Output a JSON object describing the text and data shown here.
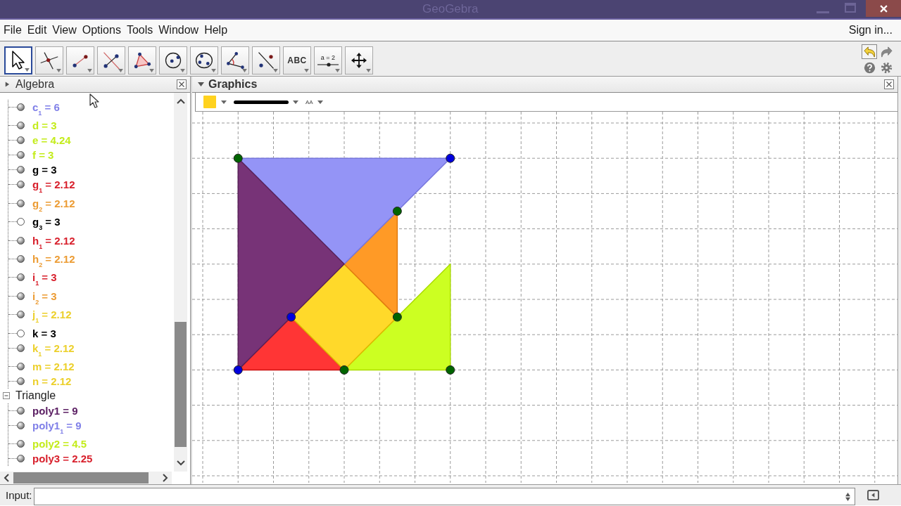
{
  "window": {
    "title": "GeoGebra"
  },
  "menu": {
    "items": [
      "File",
      "Edit",
      "View",
      "Options",
      "Tools",
      "Window",
      "Help"
    ],
    "sign_in": "Sign in..."
  },
  "toolbar": {
    "tools": [
      {
        "kind": "move",
        "selected": true
      },
      {
        "kind": "intersect",
        "selected": false
      },
      {
        "kind": "segment",
        "selected": false
      },
      {
        "kind": "perpendicular",
        "selected": false
      },
      {
        "kind": "polygon",
        "selected": false
      },
      {
        "kind": "circle",
        "selected": false
      },
      {
        "kind": "conic",
        "selected": false
      },
      {
        "kind": "angle",
        "selected": false
      },
      {
        "kind": "reflect",
        "selected": false
      },
      {
        "kind": "text",
        "label": "ABC",
        "selected": false
      },
      {
        "kind": "slider",
        "label": "a = 2",
        "selected": false
      },
      {
        "kind": "move-view",
        "selected": false
      }
    ],
    "undo": {
      "enabled": true
    },
    "redo": {
      "enabled": false
    }
  },
  "algebra": {
    "title": "Algebra",
    "style_bar_open": false,
    "groups": [
      {
        "children": [
          {
            "text": "c$_{1}$ = 6",
            "color": "#8080e8",
            "visible": true
          },
          {
            "text": "d = 3",
            "color": "#c4ec1c",
            "visible": true
          },
          {
            "text": "e = 4.24",
            "color": "#c4ec1c",
            "visible": true
          },
          {
            "text": "f = 3",
            "color": "#c4ec1c",
            "visible": true
          },
          {
            "text": "g = 3",
            "color": "#000000",
            "visible": true
          },
          {
            "text": "g$_{1}$ = 2.12",
            "color": "#d8202c",
            "visible": true
          },
          {
            "text": "g$_{2}$ = 2.12",
            "color": "#ec9c34",
            "visible": true
          },
          {
            "text": "g$_{3}$ = 3",
            "color": "#000000",
            "visible": false
          },
          {
            "text": "h$_{1}$ = 2.12",
            "color": "#d8202c",
            "visible": true
          },
          {
            "text": "h$_{2}$ = 2.12",
            "color": "#ec9c34",
            "visible": true
          },
          {
            "text": "i$_{1}$ = 3",
            "color": "#d8202c",
            "visible": true
          },
          {
            "text": "i$_{2}$ = 3",
            "color": "#ec9c34",
            "visible": true
          },
          {
            "text": "j$_{1}$ = 2.12",
            "color": "#ecd02c",
            "visible": true
          },
          {
            "text": "k = 3",
            "color": "#000000",
            "visible": false
          },
          {
            "text": "k$_{1}$ = 2.12",
            "color": "#ecd02c",
            "visible": true
          },
          {
            "text": "m = 2.12",
            "color": "#ecd02c",
            "visible": true
          },
          {
            "text": "n = 2.12",
            "color": "#ecd02c",
            "visible": true
          }
        ]
      },
      {
        "label": "Triangle",
        "expanded": true,
        "children": [
          {
            "text": "poly1 = 9",
            "color": "#5c2064",
            "visible": true
          },
          {
            "text": "poly1$_{1}$ = 9",
            "color": "#8080e8",
            "visible": true
          },
          {
            "text": "poly2 = 4.5",
            "color": "#c4ec1c",
            "visible": true
          },
          {
            "text": "poly3 = 2.25",
            "color": "#d8202c",
            "visible": true
          }
        ]
      }
    ]
  },
  "graphics": {
    "title": "Graphics",
    "style_bar_open": true,
    "style_bar": {
      "text_size_label": "AA"
    }
  },
  "input_bar": {
    "label": "Input:"
  }
}
